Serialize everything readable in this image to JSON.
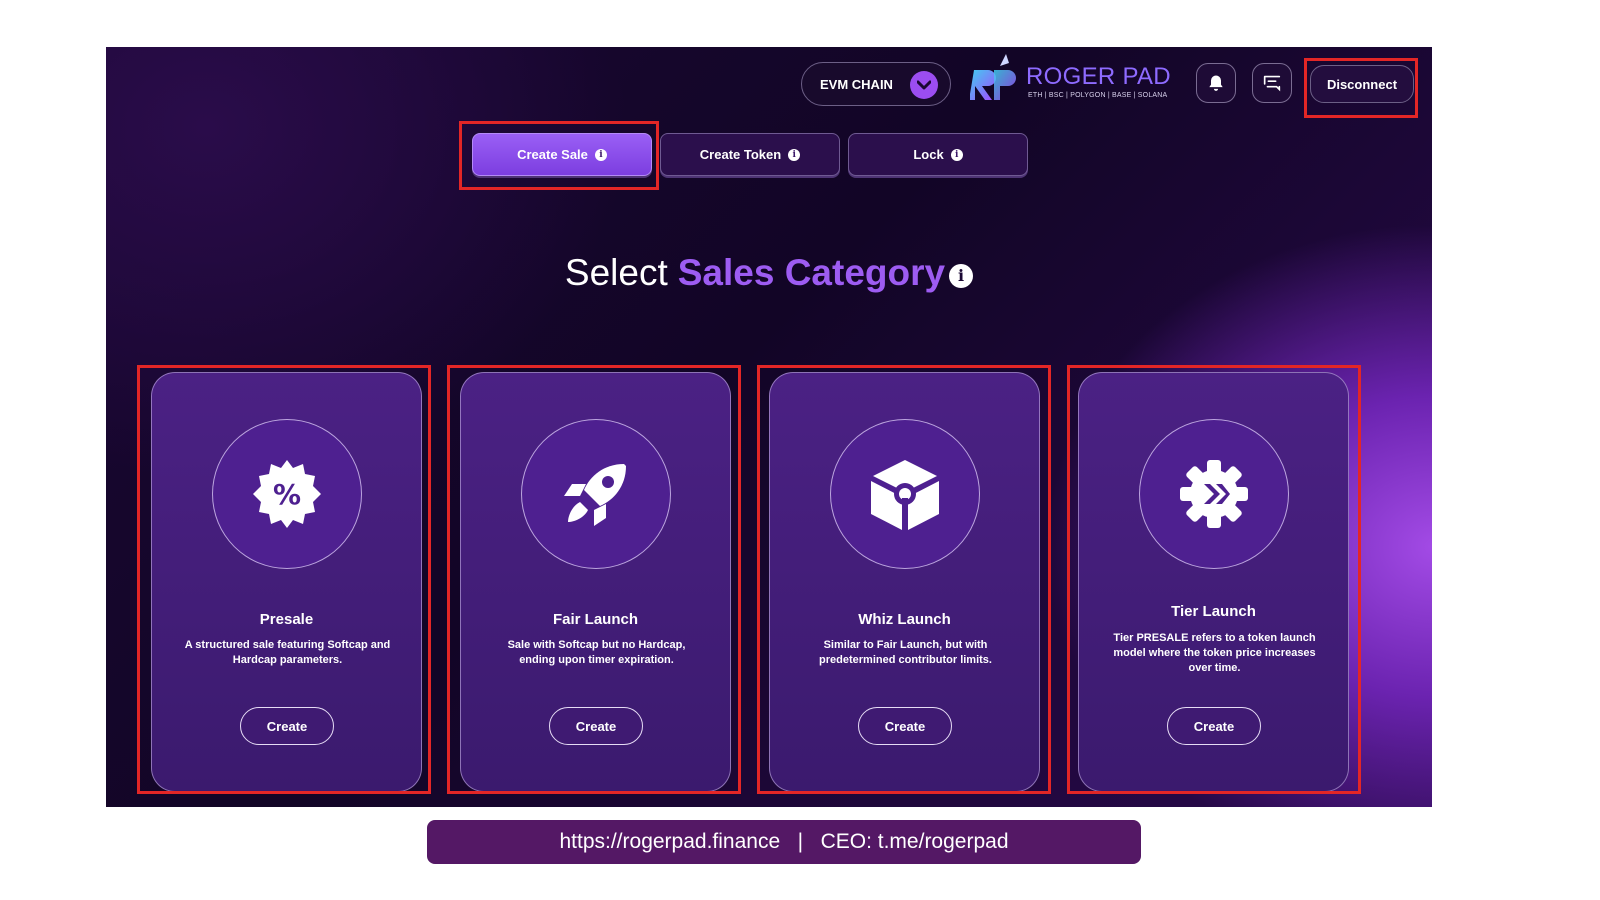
{
  "header": {
    "chain_label": "EVM CHAIN",
    "brand_name": "ROGER PAD",
    "brand_tagline": "ETH | BSC | POLYGON | BASE | SOLANA",
    "disconnect_label": "Disconnect",
    "icons": [
      "bell-icon",
      "chat-icon"
    ]
  },
  "tabs": [
    {
      "label": "Create Sale",
      "active": true
    },
    {
      "label": "Create Token",
      "active": false
    },
    {
      "label": "Lock",
      "active": false
    }
  ],
  "heading": {
    "prefix": "Select",
    "highlight": "Sales Category"
  },
  "cards": [
    {
      "title": "Presale",
      "description": "A structured sale featuring Softcap and Hardcap parameters.",
      "button": "Create",
      "icon": "percent-badge-icon"
    },
    {
      "title": "Fair Launch",
      "description": "Sale with Softcap but no Hardcap, ending upon timer expiration.",
      "button": "Create",
      "icon": "rocket-icon"
    },
    {
      "title": "Whiz Launch",
      "description": "Similar to Fair Launch, but with predetermined contributor limits.",
      "button": "Create",
      "icon": "cube-icon"
    },
    {
      "title": "Tier Launch",
      "description": "Tier PRESALE refers to a token launch model where the token price increases over time.",
      "button": "Create",
      "icon": "gear-icon"
    }
  ],
  "footer": {
    "text": "https://rogerpad.finance   |   CEO: t.me/rogerpad"
  },
  "colors": {
    "accent": "#9d5cf2",
    "highlight_border": "#e32626",
    "footer_bg": "#541865"
  }
}
